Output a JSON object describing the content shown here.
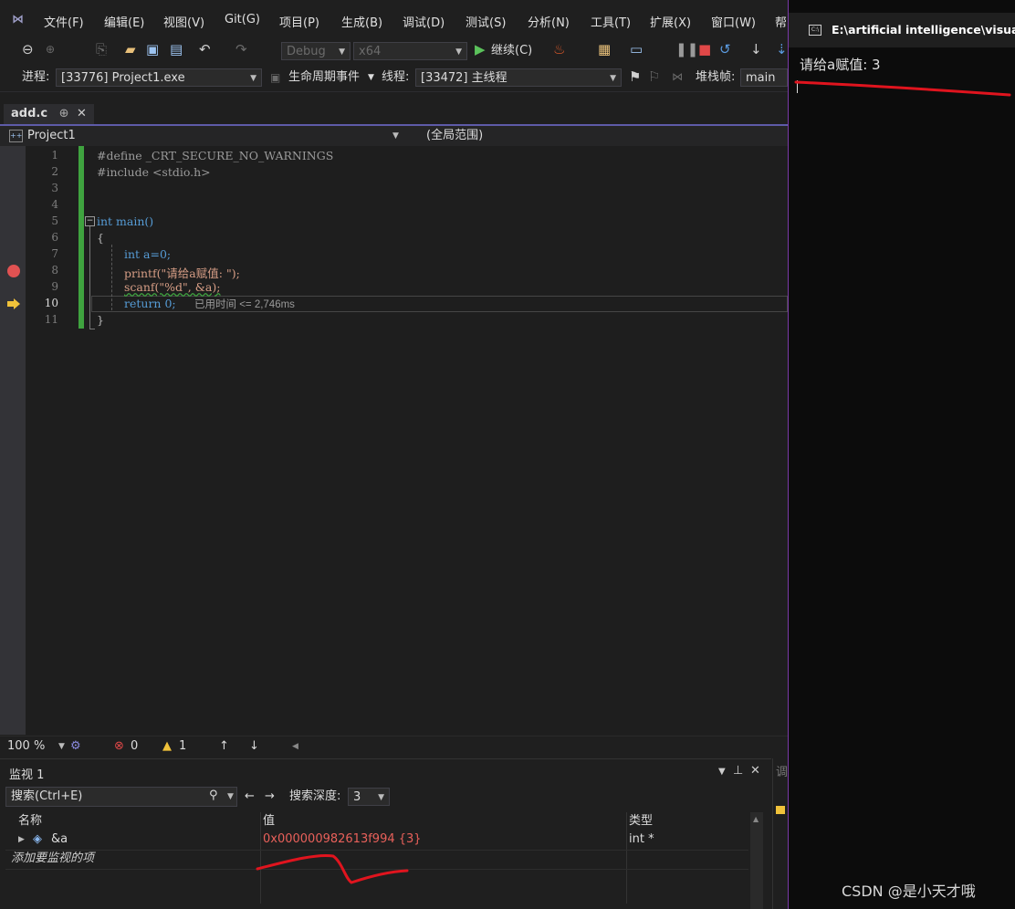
{
  "menu": [
    "文件(F)",
    "编辑(E)",
    "视图(V)",
    "Git(G)",
    "项目(P)",
    "生成(B)",
    "调试(D)",
    "测试(S)",
    "分析(N)",
    "工具(T)",
    "扩展(X)",
    "窗口(W)",
    "帮"
  ],
  "toolbar": {
    "config": "Debug",
    "platform": "x64",
    "continue_label": "继续(C)"
  },
  "debugbar": {
    "process_label": "进程:",
    "process_value": "[33776] Project1.exe",
    "lifecycle_label": "生命周期事件",
    "thread_label": "线程:",
    "thread_value": "[33472] 主线程",
    "stackframe_label": "堆栈帧:",
    "stackframe_value": "main"
  },
  "tab": {
    "filename": "add.c",
    "pin": "⊕",
    "close": "✕"
  },
  "navbar": {
    "project": "Project1",
    "scope": "(全局范围)"
  },
  "code_lines": [
    {
      "n": "1",
      "text": "#define _CRT_SECURE_NO_WARNINGS"
    },
    {
      "n": "2",
      "text": "#include <stdio.h>"
    },
    {
      "n": "3",
      "text": ""
    },
    {
      "n": "4",
      "text": ""
    },
    {
      "n": "5",
      "text": "int main()"
    },
    {
      "n": "6",
      "text": "{"
    },
    {
      "n": "7",
      "text": "int a=0;"
    },
    {
      "n": "8",
      "text": "printf(\"请给a赋值: \");"
    },
    {
      "n": "9",
      "text": "scanf(\"%d\", &a);"
    },
    {
      "n": "10",
      "text": "return 0;"
    },
    {
      "n": "11",
      "text": "}"
    }
  ],
  "perf_tip": "已用时间 <= 2,746ms",
  "status": {
    "zoom": "100 %",
    "errors": "0",
    "warnings": "1"
  },
  "watch": {
    "title": "监视 1",
    "search_placeholder": "搜索(Ctrl+E)",
    "search_depth_label": "搜索深度:",
    "search_depth_value": "3",
    "col_name": "名称",
    "col_value": "值",
    "col_type": "类型",
    "rows": [
      {
        "name": "&a",
        "value": "0x000000982613f994 {3}",
        "type": "int *"
      }
    ],
    "add_placeholder": "添加要监视的项"
  },
  "side_stub_text": "调",
  "console": {
    "title": "E:\\artificial intelligence\\visual",
    "output": "请给a赋值: 3"
  },
  "watermark": "CSDN @是小天才哦",
  "colors": {
    "accent": "#5e5ba8",
    "annotation_red": "#e0141e",
    "breakpoint": "#e05252",
    "changed_bar": "#3fa33f"
  }
}
